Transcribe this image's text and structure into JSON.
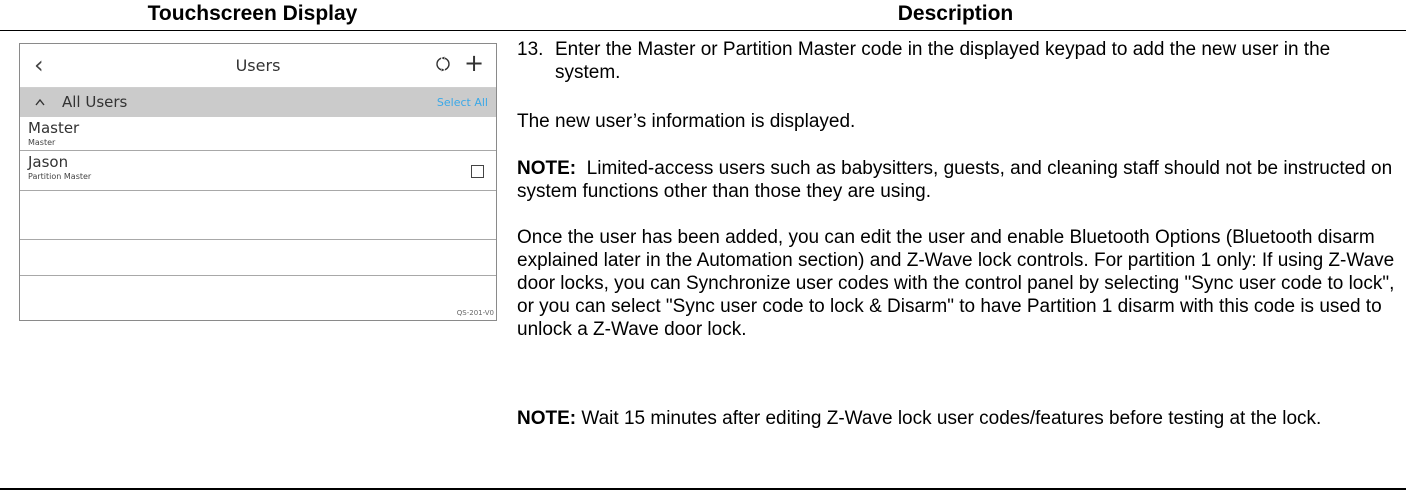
{
  "table": {
    "header_left": "Touchscreen Display",
    "header_right": "Description"
  },
  "screen": {
    "title": "Users",
    "back_icon": "chevron-left-icon",
    "refresh_icon": "refresh-icon",
    "add_icon": "plus-icon",
    "group_label": "All Users",
    "select_all": "Select All",
    "users": [
      {
        "name": "Master",
        "role": "Master",
        "checkbox": false
      },
      {
        "name": "Jason",
        "role": "Partition Master",
        "checkbox": true
      }
    ],
    "image_code": "QS-201-V0",
    "accent_color": "#3aa8e8"
  },
  "description": {
    "step_number": "13.",
    "step_text": "Enter the Master or Partition Master code in the displayed keypad to add the new user in the system.",
    "info": "The new user’s information is displayed.",
    "note1_label": "NOTE:",
    "note1_text": "Limited-access users such as babysitters, guests, and cleaning staff should not be instructed on system functions other than those they are using.",
    "paragraph": "Once the user has been added, you can edit the user and enable Bluetooth Options (Bluetooth disarm explained later in the Automation section) and Z-Wave lock controls.  For partition 1 only: If using Z-Wave door locks, you can Synchronize user codes with the control panel by selecting \"Sync user code to lock\", or you can select \"Sync user code to lock & Disarm\" to have Partition 1 disarm with this code is used to unlock a Z-Wave door lock.",
    "note2_label": "NOTE:",
    "note2_text": "Wait 15 minutes after editing Z-Wave lock user codes/features before testing at the lock."
  }
}
